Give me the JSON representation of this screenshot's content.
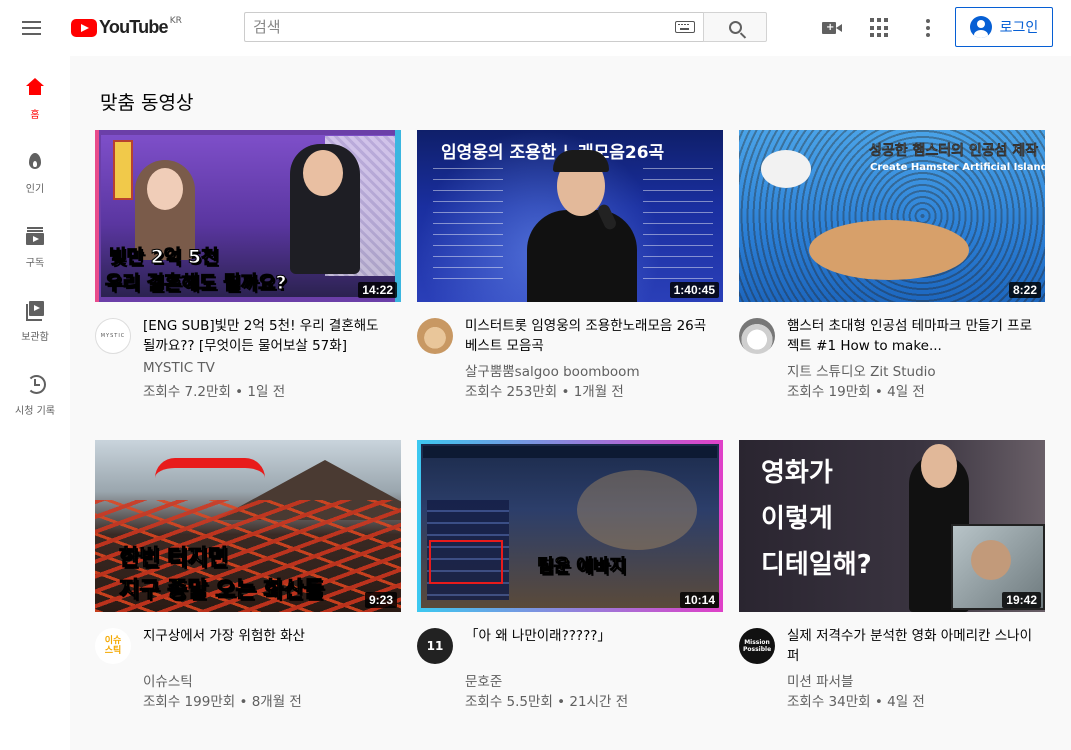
{
  "header": {
    "logo_text": "YouTube",
    "logo_region": "KR",
    "search_placeholder": "검색",
    "signin_label": "로그인"
  },
  "sidebar": {
    "items": [
      {
        "label": "홈",
        "icon": "home-icon",
        "active": true
      },
      {
        "label": "인기",
        "icon": "fire-icon"
      },
      {
        "label": "구독",
        "icon": "subscriptions-icon"
      },
      {
        "label": "보관함",
        "icon": "library-icon"
      },
      {
        "label": "시청 기록",
        "icon": "history-icon"
      }
    ]
  },
  "main": {
    "section_title": "맞춤 동영상",
    "videos": [
      {
        "title": "[ENG SUB]빛만 2억 5천! 우리 결혼해도 될까요?? [무엇이든 물어보살 57화]",
        "channel": "MYSTIC TV",
        "stats": "조회수 7.2만회 • 1일 전",
        "duration": "14:22",
        "thumb_text_1": "빛만 2억 5천",
        "thumb_text_2": "우리 결혼해도 될까요?",
        "avatar_text": "MYSTIC"
      },
      {
        "title": "미스터트롯 임영웅의 조용한노래모음 26곡 베스트 모음곡",
        "channel": "살구뿜뿜salgoo boomboom",
        "stats": "조회수 253만회 • 1개월 전",
        "duration": "1:40:45",
        "thumb_text_1": "임영웅의 조용한 노래모음26곡"
      },
      {
        "title": "햄스터 초대형 인공섬 테마파크 만들기 프로젝트 #1 How to make...",
        "channel": "지트 스튜디오 Zit Studio",
        "stats": "조회수 19만회 • 4일 전",
        "duration": "8:22",
        "thumb_text_1": "성공한 햄스터의 인공섬 제작",
        "thumb_text_2": "Create Hamster Artificial Island"
      },
      {
        "title": "지구상에서 가장 위험한 화산",
        "channel": "이슈스틱",
        "stats": "조회수 199만회 • 8개월 전",
        "duration": "9:23",
        "thumb_text_1": "한번 터지면",
        "thumb_text_2": "지구 종말 오는 화산들",
        "avatar_text": "이슈스틱"
      },
      {
        "title": "「아 왜 나만이래?????」",
        "channel": "문호준",
        "stats": "조회수 5.5만회 • 21시간 전",
        "duration": "10:14",
        "thumb_text_1": "팀운 에바지",
        "avatar_text": "11"
      },
      {
        "title": "실제 저격수가 분석한 영화 아메리칸 스나이퍼",
        "channel": "미션 파서블",
        "stats": "조회수 34만회 • 4일 전",
        "duration": "19:42",
        "thumb_text_1": "영화가",
        "thumb_text_2": "이렇게",
        "thumb_text_3": "디테일해?",
        "avatar_text": "Mission Possible"
      }
    ]
  },
  "colors": {
    "brand_red": "#ff0000",
    "link_blue": "#065fd4"
  }
}
